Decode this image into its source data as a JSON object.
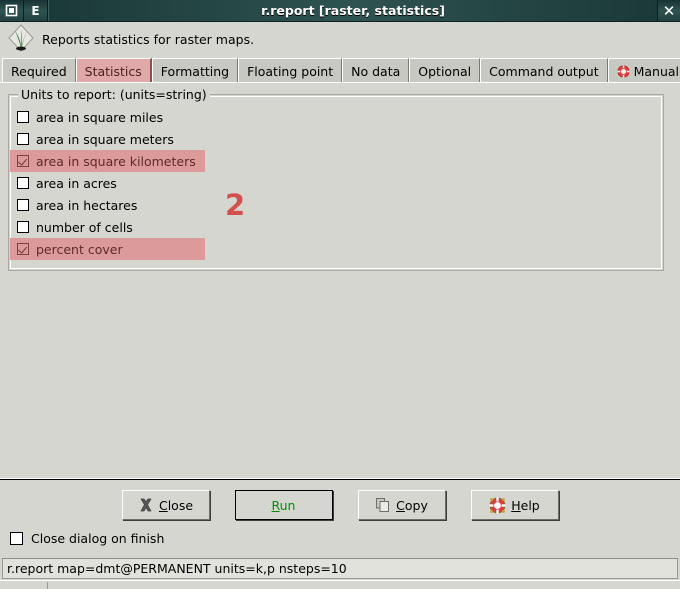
{
  "window": {
    "title": "r.report [raster, statistics]",
    "icon_square": "window-restore-icon",
    "icon_e": "E",
    "close_label": "✕"
  },
  "header": {
    "description": "Reports statistics for raster maps.",
    "logo": "grass-gis-logo"
  },
  "tabs": [
    {
      "label": "Required",
      "selected": false,
      "icon": null
    },
    {
      "label": "Statistics",
      "selected": true,
      "icon": null
    },
    {
      "label": "Formatting",
      "selected": false,
      "icon": null
    },
    {
      "label": "Floating point",
      "selected": false,
      "icon": null
    },
    {
      "label": "No data",
      "selected": false,
      "icon": null
    },
    {
      "label": "Optional",
      "selected": false,
      "icon": null
    },
    {
      "label": "Command output",
      "selected": false,
      "icon": null
    },
    {
      "label": "Manual",
      "selected": false,
      "icon": "lifebuoy-icon"
    }
  ],
  "groupbox": {
    "label": "Units to report:  (units=string)",
    "options": [
      {
        "label": "area in square miles",
        "checked": false,
        "highlighted": false
      },
      {
        "label": "area in square meters",
        "checked": false,
        "highlighted": false
      },
      {
        "label": "area in square kilometers",
        "checked": true,
        "highlighted": true
      },
      {
        "label": "area in acres",
        "checked": false,
        "highlighted": false
      },
      {
        "label": "area in hectares",
        "checked": false,
        "highlighted": false
      },
      {
        "label": "number of cells",
        "checked": false,
        "highlighted": false
      },
      {
        "label": "percent cover",
        "checked": true,
        "highlighted": true
      }
    ]
  },
  "annotation": {
    "step_number": "2",
    "color": "#d4504f"
  },
  "buttons": [
    {
      "id": "close",
      "label": "Close",
      "mnemonic": "C",
      "icon": "close-x-icon",
      "focused": false,
      "text_color": "#000000"
    },
    {
      "id": "run",
      "label": "Run",
      "mnemonic": "R",
      "icon": null,
      "focused": true,
      "text_color": "#009000"
    },
    {
      "id": "copy",
      "label": "Copy",
      "mnemonic": "C",
      "icon": "copy-icon",
      "focused": false,
      "text_color": "#000000"
    },
    {
      "id": "help",
      "label": "Help",
      "mnemonic": "H",
      "icon": "lifebuoy-icon",
      "focused": false,
      "text_color": "#000000"
    }
  ],
  "close_on_finish": {
    "label": "Close dialog on finish",
    "checked": false
  },
  "command_line": {
    "value": "r.report map=dmt@PERMANENT units=k,p nsteps=10"
  },
  "colors": {
    "highlight_pink": "#dd9a9a",
    "tab_selected": "#e0a8a8",
    "annotation_red": "#d4504f",
    "window_bg": "#d6d6d0",
    "titlebar_dark": "#23403e",
    "run_green": "#009000"
  }
}
